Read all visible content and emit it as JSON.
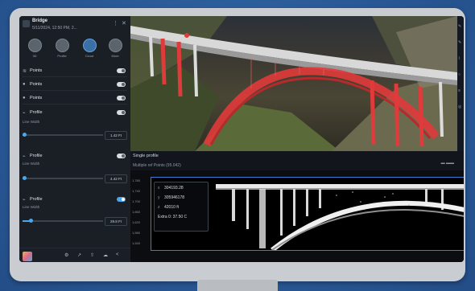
{
  "app": {
    "title": "Bridge",
    "subtitle": "5/11/2024, 12:50 PM, 2...",
    "more_icon": "more-vertical-icon",
    "close_icon": "close-icon"
  },
  "modes": [
    {
      "label": "3D",
      "icon": "sphere-icon",
      "active": false
    },
    {
      "label": "Profile",
      "icon": "profile-icon",
      "active": false
    },
    {
      "label": "Cloud",
      "icon": "cloud-icon",
      "active": true
    },
    {
      "label": "More",
      "icon": "more-icon",
      "active": false
    }
  ],
  "layers": [
    {
      "label": "Points",
      "icon": "layers-icon",
      "on": false
    },
    {
      "label": "Points",
      "icon": "pin-icon",
      "on": false
    },
    {
      "label": "Points",
      "icon": "pin-icon",
      "on": false
    }
  ],
  "profiles": [
    {
      "label": "Profile",
      "sub_label": "Line Width",
      "value": "1.42 Ft",
      "on": false,
      "level": 0.02
    },
    {
      "label": "Profile",
      "sub_label": "Line Width",
      "value": "4.42 Ft",
      "on": false,
      "level": 0.02
    },
    {
      "label": "Profile",
      "sub_label": "Line Width",
      "value": "29.8 Ft",
      "on": true,
      "level": 0.1
    }
  ],
  "bottom_icons": [
    "settings-icon",
    "measure-icon",
    "share-icon",
    "cloud-upload-icon",
    "forward-icon"
  ],
  "profile_panel": {
    "title": "Single profile",
    "subtitle": "Multiple ref Points (95.042)",
    "controls": "▬ ▬▬"
  },
  "readout": {
    "x": "304193.28",
    "y": "305946178",
    "z": "42010 ft",
    "extra": "Extra 0: 37.50 C"
  },
  "y_ticks": [
    "1,780",
    "1,740",
    "1,700",
    "1,660",
    "1,620",
    "1,580",
    "1,540"
  ],
  "colors": {
    "accent": "#4da6e8",
    "highlight": "#e03a3a",
    "profile_frame": "#3d7cd6"
  }
}
